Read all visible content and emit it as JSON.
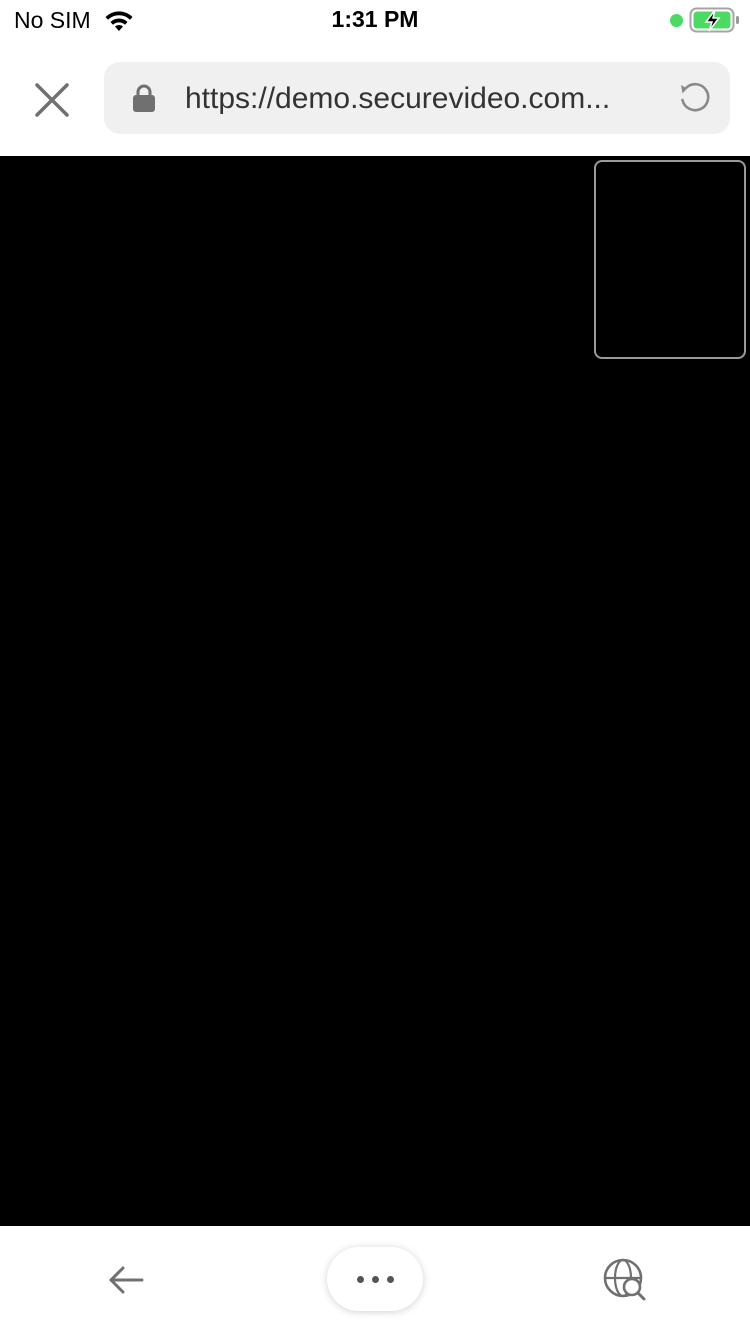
{
  "status_bar": {
    "carrier": "No SIM",
    "time": "1:31 PM",
    "indicator_color": "#4cd964",
    "battery_color": "#4cd964",
    "wifi_icon": "wifi-icon",
    "battery_icon": "battery-charging-icon"
  },
  "browser": {
    "close_icon": "close-icon",
    "lock_icon": "lock-icon",
    "url": "https://demo.securevideo.com...",
    "reload_icon": "reload-icon"
  },
  "video": {
    "background": "#000000",
    "self_view_border": "#9a9a9a"
  },
  "bottom_bar": {
    "back_icon": "arrow-left-icon",
    "more_icon": "more-dots-icon",
    "globe_search_icon": "globe-search-icon"
  }
}
